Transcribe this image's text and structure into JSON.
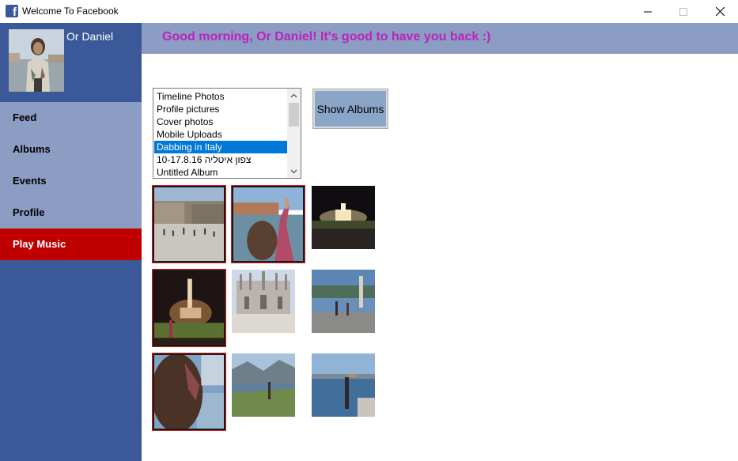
{
  "window": {
    "title": "Welcome To Facebook"
  },
  "user": {
    "name": "Or Daniel"
  },
  "greeting": "Good morning, Or Daniel! It's good to have you back :)",
  "nav": {
    "items": [
      {
        "label": "Feed"
      },
      {
        "label": "Albums"
      },
      {
        "label": "Events"
      },
      {
        "label": "Profile"
      },
      {
        "label": "Play Music"
      }
    ]
  },
  "albums": {
    "items": [
      "Timeline Photos",
      "Profile pictures",
      "Cover photos",
      "Mobile Uploads",
      "Dabbing in Italy",
      "10-17.8.16 צפון איטליה",
      "Untitled Album"
    ],
    "selected": "Dabbing in Italy"
  },
  "show_albums_label": "Show Albums",
  "colors": {
    "sidebar": "#3b5998",
    "nav_item": "#8b9dc3",
    "play_music": "#c00000",
    "greeting_text": "#c020c0",
    "selection": "#0078d7"
  }
}
